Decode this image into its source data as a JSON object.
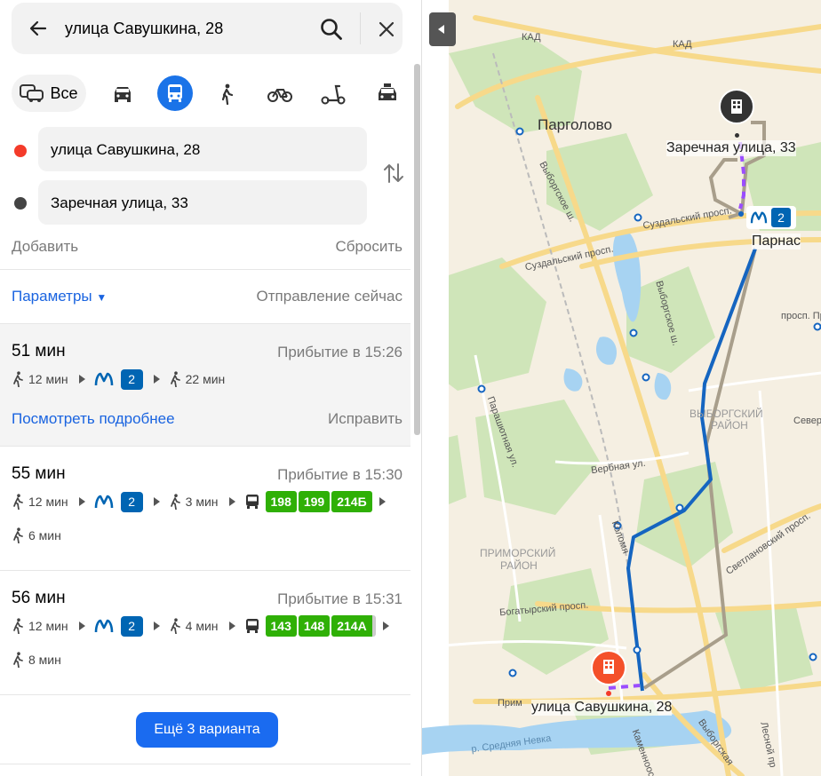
{
  "search": {
    "query": "улица Савушкина, 28"
  },
  "modes": {
    "all_label": "Все",
    "items": [
      "car-icon",
      "bus-icon",
      "walk-icon",
      "bike-icon",
      "scooter-icon",
      "taxi-icon"
    ],
    "selected": "bus-icon"
  },
  "route_points": {
    "from": "улица Савушкина, 28",
    "to": "Заречная улица, 33",
    "add_label": "Добавить",
    "reset_label": "Сбросить"
  },
  "params": {
    "label": "Параметры",
    "departure": "Отправление сейчас"
  },
  "routes": [
    {
      "duration": "51 мин",
      "arrival": "Прибытие в 15:26",
      "walk1": "12 мин",
      "metro_line": "2",
      "walk2": "22 мин",
      "details_label": "Посмотреть подробнее",
      "fix_label": "Исправить"
    },
    {
      "duration": "55 мин",
      "arrival": "Прибытие в 15:30",
      "walk1": "12 мин",
      "metro_line": "2",
      "walk2": "3 мин",
      "buses": [
        "198",
        "199",
        "214Б"
      ],
      "walk3": "6 мин"
    },
    {
      "duration": "56 мин",
      "arrival": "Прибытие в 15:31",
      "walk1": "12 мин",
      "metro_line": "2",
      "walk2": "4 мин",
      "buses": [
        "143",
        "148",
        "214А"
      ],
      "walk3": "8 мин"
    }
  ],
  "more_label": "Ещё 3 варианта",
  "map": {
    "labels": {
      "kad1": "КАД",
      "kad2": "КАД",
      "pargolovo": "Парголово",
      "vyborgskoe_sh": "Выборгское ш.",
      "vyborgskoe_sh2": "Выборгское ш.",
      "suzdal1": "Суздальский просп.",
      "suzdal2": "Суздальский просп.",
      "prosp": "просп. Пр",
      "vyborg_district1": "ВЫБОРГСКИЙ",
      "vyborg_district2": "РАЙОН",
      "severny": "Северн",
      "parashut": "Парашютная ул.",
      "verbnaya": "Вербная ул.",
      "kolomyazh": "Коломя",
      "svetlan": "Светлановский просп.",
      "primorsky1": "ПРИМОРСКИЙ",
      "primorsky2": "РАЙОН",
      "bogatyr": "Богатырский просп.",
      "prim": "Прим",
      "sred_nevka": "р. Средняя Невка",
      "kamenno": "Каменноос",
      "vyborg_nab": "Выборгская",
      "lesnoy": "Лесной пр"
    },
    "dest_label": "Заречная улица, 33",
    "metro_station": "Парнас",
    "metro_line": "2",
    "origin_label": "улица Савушкина, 28"
  }
}
